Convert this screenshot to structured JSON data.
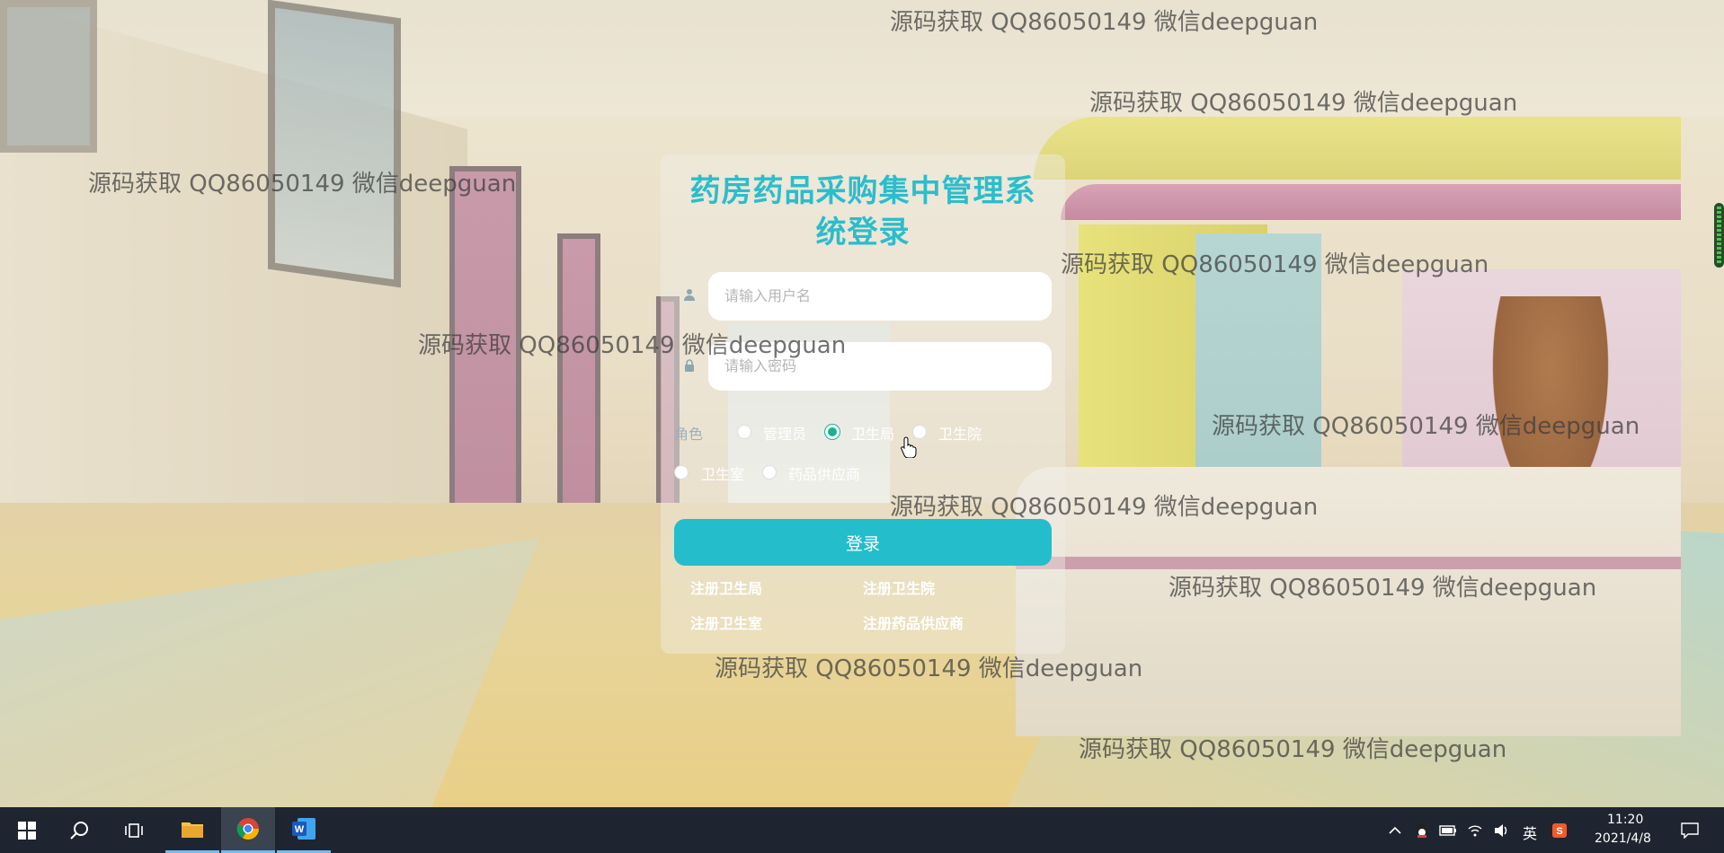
{
  "watermark_text": "源码获取 QQ86050149 微信deepguan",
  "login": {
    "title_line1": "药房药品采购集中管理系",
    "title_line2": "统登录",
    "username_placeholder": "请输入用户名",
    "password_placeholder": "请输入密码",
    "role_label": "角色",
    "roles": [
      {
        "label": "管理员",
        "selected": false
      },
      {
        "label": "卫生局",
        "selected": true
      },
      {
        "label": "卫生院",
        "selected": false
      },
      {
        "label": "卫生室",
        "selected": false
      },
      {
        "label": "药品供应商",
        "selected": false
      }
    ],
    "login_button": "登录",
    "register_links": [
      "注册卫生局",
      "注册卫生院",
      "注册卫生室",
      "注册药品供应商"
    ]
  },
  "taskbar": {
    "apps": [
      "windows-start",
      "search",
      "task-view",
      "file-explorer",
      "chrome",
      "word"
    ],
    "tray": {
      "ime": "英",
      "time": "11:20",
      "date": "2021/4/8"
    }
  },
  "colors": {
    "accent": "#23bdcc",
    "title": "#2bbdcc",
    "radio_selected": "#14b58f",
    "taskbar": "#1e2530"
  }
}
